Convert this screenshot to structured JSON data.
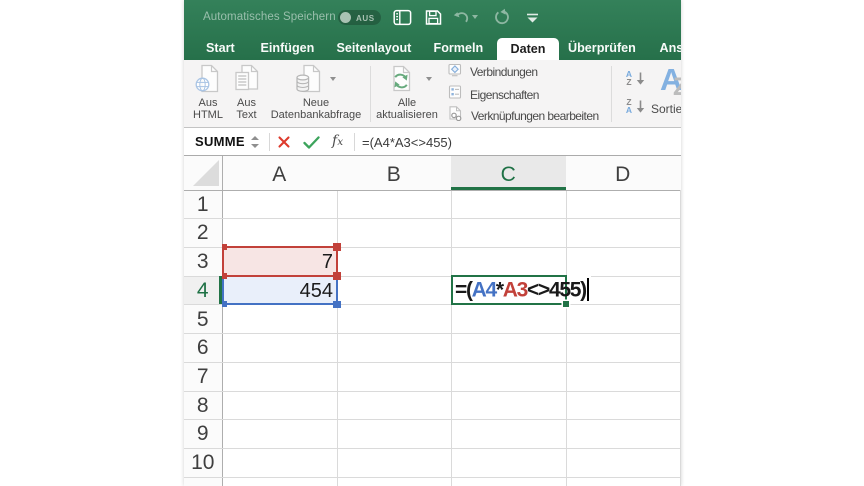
{
  "titlebar": {
    "autosave_label": "Automatisches Speichern",
    "autosave_state": "AUS"
  },
  "tabs": [
    {
      "label": "Start",
      "active": false
    },
    {
      "label": "Einfügen",
      "active": false
    },
    {
      "label": "Seitenlayout",
      "active": false
    },
    {
      "label": "Formeln",
      "active": false
    },
    {
      "label": "Daten",
      "active": true
    },
    {
      "label": "Überprüfen",
      "active": false
    },
    {
      "label": "Ansicht",
      "active": false
    }
  ],
  "ribbon": {
    "big_buttons": [
      {
        "id": "aus-html",
        "icon": "html-page-icon",
        "label_lines": [
          "Aus",
          "HTML"
        ],
        "caret": false
      },
      {
        "id": "aus-text",
        "icon": "text-file-icon",
        "label_lines": [
          "Aus",
          "Text"
        ],
        "caret": false
      },
      {
        "id": "neue-datenbankabfrage",
        "icon": "database-query-icon",
        "label_lines": [
          "Neue",
          "Datenbankabfrage"
        ],
        "caret": true
      },
      {
        "id": "alle-aktualisieren",
        "icon": "refresh-icon",
        "label_lines": [
          "Alle",
          "aktualisieren"
        ],
        "caret": true
      }
    ],
    "stack_buttons": [
      {
        "id": "verbindungen",
        "icon": "connections-icon",
        "label": "Verbindungen"
      },
      {
        "id": "eigenschaften",
        "icon": "properties-icon",
        "label": "Eigenschaften"
      },
      {
        "id": "verknuepfungen-bearbeiten",
        "icon": "edit-links-icon",
        "label": "Verknüpfungen bearbeiten"
      }
    ],
    "sort_small": [
      {
        "id": "sort-asc",
        "top_letter": "A",
        "bottom_letter": "Z"
      },
      {
        "id": "sort-desc",
        "top_letter": "Z",
        "bottom_letter": "A"
      }
    ],
    "sort_big": {
      "label": "Sortieren",
      "letter_a": "A",
      "letter_z": "Z"
    }
  },
  "formula_bar": {
    "name_box": "SUMME",
    "fx_label": "fx",
    "formula": "=(A4*A3<>455)"
  },
  "grid": {
    "columns": [
      "A",
      "B",
      "C",
      "D"
    ],
    "active_column": "C",
    "rows": [
      1,
      2,
      3,
      4,
      5,
      6,
      7,
      8,
      9,
      10
    ],
    "active_row": 4,
    "cells": [
      {
        "ref": "A3",
        "value": "7",
        "highlight": "red"
      },
      {
        "ref": "A4",
        "value": "454",
        "highlight": "blue"
      }
    ],
    "editing_cell": {
      "ref": "C4",
      "parts": [
        {
          "t": "=(",
          "c": "default"
        },
        {
          "t": "A4",
          "c": "blue"
        },
        {
          "t": "*",
          "c": "default"
        },
        {
          "t": "A3",
          "c": "red"
        },
        {
          "t": "<>455)",
          "c": "default"
        }
      ]
    }
  },
  "colors": {
    "accent_green": "#217346",
    "ref_blue": "#4472c4",
    "ref_red": "#c2413a",
    "fill_blue": "#e9effa",
    "fill_red": "#f7e5e4",
    "formula_default": "#1a1a1a"
  }
}
